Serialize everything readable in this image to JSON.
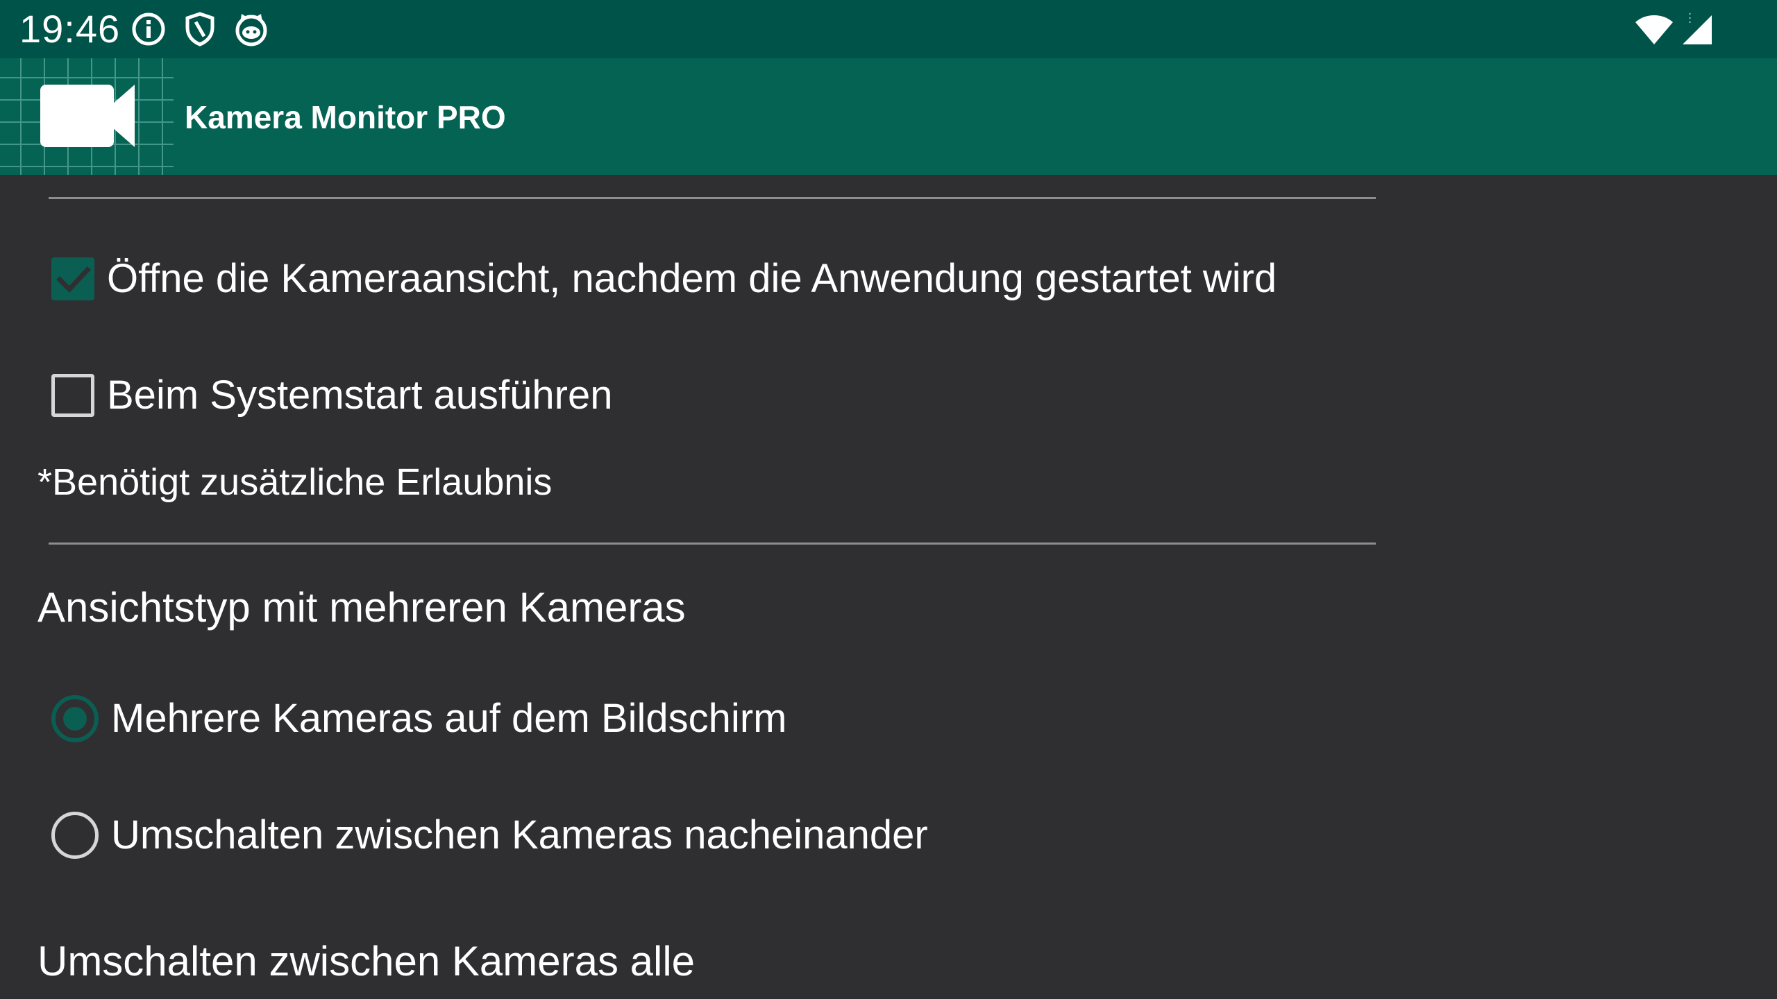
{
  "status_bar": {
    "time": "19:46",
    "left_icons": [
      "info-icon",
      "shield-icon",
      "cat-icon"
    ],
    "right_icons": [
      "wifi-icon",
      "cellular-signal-icon"
    ]
  },
  "app_bar": {
    "icon": "video-camera-icon",
    "title": "Kamera Monitor PRO"
  },
  "settings": {
    "open_camera_view": {
      "label": "Öffne die Kameraansicht, nachdem die Anwendung gestartet wird",
      "checked": true
    },
    "run_on_boot": {
      "label": "Beim Systemstart ausführen",
      "checked": false
    },
    "permission_note": "*Benötigt zusätzliche Erlaubnis",
    "multi_camera_section": {
      "title": "Ansichtstyp mit mehreren Kameras",
      "options": [
        {
          "label": "Mehrere Kameras auf dem Bildschirm",
          "selected": true
        },
        {
          "label": "Umschalten zwischen Kameras nacheinander",
          "selected": false
        }
      ]
    },
    "switch_interval_title": "Umschalten zwischen Kameras alle"
  },
  "colors": {
    "status_bar": "#005348",
    "app_bar": "#056354",
    "background": "#2f2f31",
    "accent": "#0b5e52",
    "divider": "#8e8e8e"
  }
}
